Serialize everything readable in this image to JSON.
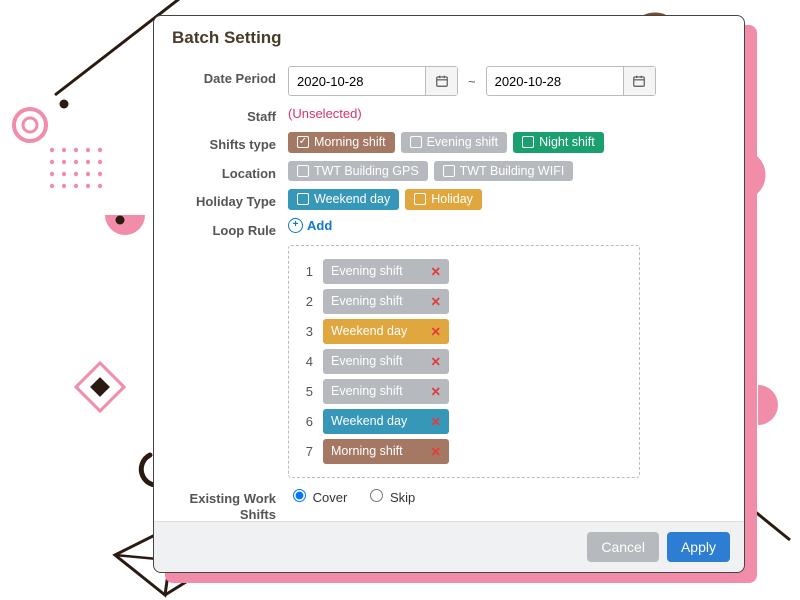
{
  "title": "Batch Setting",
  "labels": {
    "date_period": "Date Period",
    "staff": "Staff",
    "shifts_type": "Shifts type",
    "location": "Location",
    "holiday_type": "Holiday Type",
    "loop_rule": "Loop Rule",
    "existing": "Existing Work Shifts"
  },
  "date_period": {
    "from": "2020-10-28",
    "to": "2020-10-28",
    "separator": "~"
  },
  "staff": {
    "value": "(Unselected)"
  },
  "shifts_type": [
    {
      "label": "Morning shift",
      "color": "brown",
      "checked": true
    },
    {
      "label": "Evening shift",
      "color": "grey",
      "checked": false
    },
    {
      "label": "Night shift",
      "color": "green",
      "checked": false
    }
  ],
  "location": [
    {
      "label": "TWT Building GPS",
      "color": "grey",
      "checked": false
    },
    {
      "label": "TWT Building WIFI",
      "color": "grey",
      "checked": false
    }
  ],
  "holiday_type": [
    {
      "label": "Weekend day",
      "color": "teal",
      "checked": false
    },
    {
      "label": "Holiday",
      "color": "orange",
      "checked": false
    }
  ],
  "loop_rule": {
    "add_label": "Add",
    "items": [
      {
        "idx": "1",
        "label": "Evening shift",
        "color": "grey"
      },
      {
        "idx": "2",
        "label": "Evening shift",
        "color": "grey"
      },
      {
        "idx": "3",
        "label": "Weekend day",
        "color": "orange"
      },
      {
        "idx": "4",
        "label": "Evening shift",
        "color": "grey"
      },
      {
        "idx": "5",
        "label": "Evening shift",
        "color": "grey"
      },
      {
        "idx": "6",
        "label": "Weekend day",
        "color": "teal"
      },
      {
        "idx": "7",
        "label": "Morning shift",
        "color": "brown"
      }
    ]
  },
  "existing": {
    "options": {
      "cover": "Cover",
      "skip": "Skip"
    },
    "selected": "cover"
  },
  "footer": {
    "cancel": "Cancel",
    "apply": "Apply"
  }
}
